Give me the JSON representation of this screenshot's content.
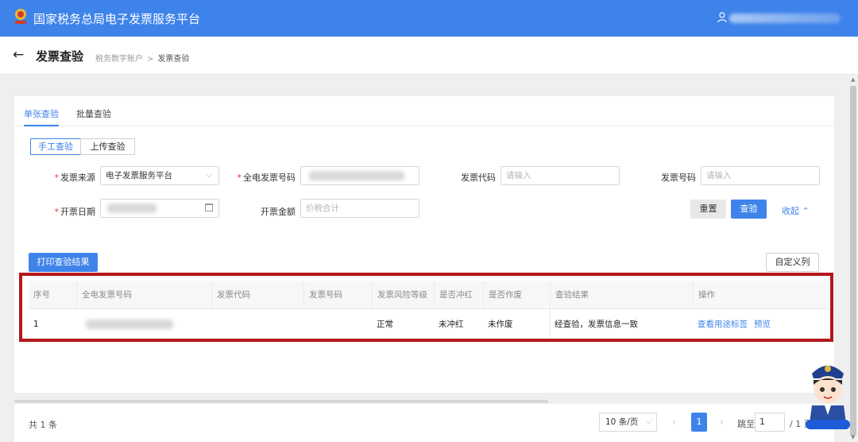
{
  "header": {
    "app_title": "国家税务总局电子发票服务平台"
  },
  "page": {
    "back_icon": "arrow-left-icon",
    "title": "发票查验",
    "breadcrumb": [
      "税务数字账户",
      "发票查验"
    ],
    "breadcrumb_sep": ">"
  },
  "tabs": [
    {
      "label": "单张查验",
      "active": true
    },
    {
      "label": "批量查验",
      "active": false
    }
  ],
  "mode_toggle": [
    {
      "label": "手工查验",
      "active": true
    },
    {
      "label": "上传查验",
      "active": false
    }
  ],
  "form": {
    "source": {
      "label": "发票来源",
      "required": true,
      "value": "电子发票服务平台"
    },
    "full_number": {
      "label": "全电发票号码",
      "required": true
    },
    "invoice_code": {
      "label": "发票代码",
      "placeholder": "请输入"
    },
    "invoice_no": {
      "label": "发票号码",
      "placeholder": "请输入"
    },
    "issue_date": {
      "label": "开票日期",
      "required": true
    },
    "amount": {
      "label": "开票金额",
      "placeholder": "价税合计"
    },
    "reset_label": "重置",
    "check_label": "查验",
    "collapse_label": "收起"
  },
  "toolbar": {
    "print_label": "打印查验结果",
    "custom_columns_label": "自定义列"
  },
  "table": {
    "headers": [
      "序号",
      "全电发票号码",
      "发票代码",
      "发票号码",
      "发票风险等级",
      "是否冲红",
      "是否作废",
      "查验结果",
      "操作"
    ],
    "rows": [
      {
        "index": "1",
        "risk": "正常",
        "red": "未冲红",
        "void": "未作废",
        "result": "经查验，发票信息一致",
        "actions": [
          "查看用途标签",
          "预览"
        ]
      }
    ]
  },
  "footer": {
    "total": "共 1 条",
    "page_size": "10 条/页",
    "current_page": "1",
    "jump_label": "跳至",
    "jump_value": "1",
    "page_total": "/ 1 页"
  },
  "colors": {
    "primary": "#3e83ea",
    "highlight": "#b3181b",
    "required": "#e23c3c"
  }
}
